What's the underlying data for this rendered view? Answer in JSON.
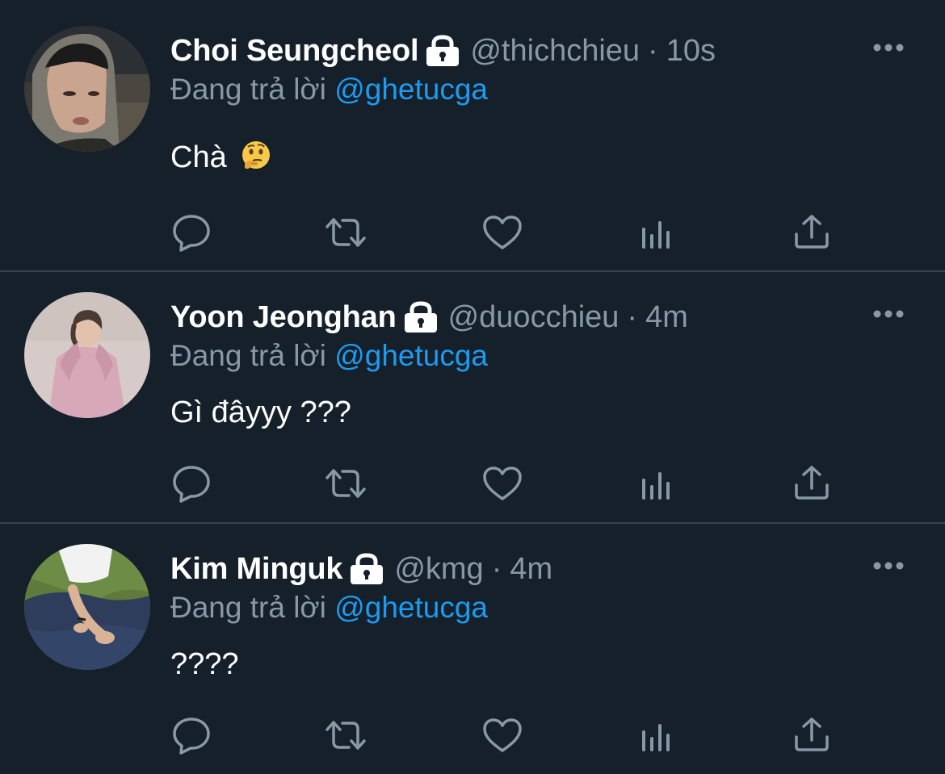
{
  "tweets": [
    {
      "name": "Choi Seungcheol",
      "handle": "@thichchieu",
      "separator": "·",
      "time": "10s",
      "reply_prefix": "Đang trả lời",
      "reply_mention": "@ghetucga",
      "text": "Chà",
      "emoji": "thinking-face"
    },
    {
      "name": "Yoon Jeonghan",
      "handle": "@duocchieu",
      "separator": "·",
      "time": "4m",
      "reply_prefix": "Đang trả lời",
      "reply_mention": "@ghetucga",
      "text": "Gì đâyyy ???"
    },
    {
      "name": "Kim Minguk",
      "handle": "@kmg",
      "separator": "·",
      "time": "4m",
      "reply_prefix": "Đang trả lời",
      "reply_mention": "@ghetucga",
      "text": "????"
    }
  ],
  "icons": {
    "protected": "lock-icon",
    "more": "more-icon",
    "reply": "reply-icon",
    "retweet": "retweet-icon",
    "like": "like-icon",
    "analytics": "analytics-icon",
    "share": "share-icon"
  },
  "colors": {
    "background": "#15202b",
    "divider": "#38444d",
    "secondary_text": "#8899a6",
    "mention": "#1d9bf0",
    "primary_text": "#ffffff"
  }
}
